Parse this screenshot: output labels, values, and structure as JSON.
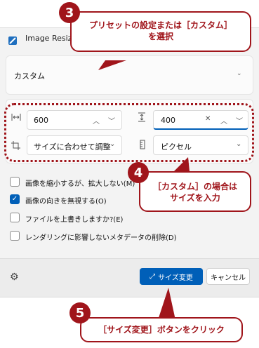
{
  "window": {
    "title": "Image Resizer"
  },
  "preset": {
    "value": "カスタム"
  },
  "sizes": {
    "width_value": "600",
    "height_value": "400",
    "fit_mode": "サイズに合わせて調整",
    "unit": "ピクセル"
  },
  "options": [
    {
      "label": "画像を縮小するが、拡大しない(M)",
      "checked": false
    },
    {
      "label": "画像の向きを無視する(O)",
      "checked": true
    },
    {
      "label": "ファイルを上書きしますか?(E)",
      "checked": false
    },
    {
      "label": "レンダリングに影響しないメタデータの削除(D)",
      "checked": false
    }
  ],
  "footer": {
    "resize_label": "サイズ変更",
    "cancel_label": "キャンセル"
  },
  "annotations": {
    "step3_number": "3",
    "step3_line1": "プリセットの設定または［カスタム］",
    "step3_line2": "を選択",
    "step4_number": "4",
    "step4_line1": "［カスタム］の場合は",
    "step4_line2": "サイズを入力",
    "step5_number": "5",
    "step5_text": "［サイズ変更］ボタンをクリック"
  },
  "colors": {
    "accent": "#005fb8",
    "annotation": "#a0151b"
  }
}
